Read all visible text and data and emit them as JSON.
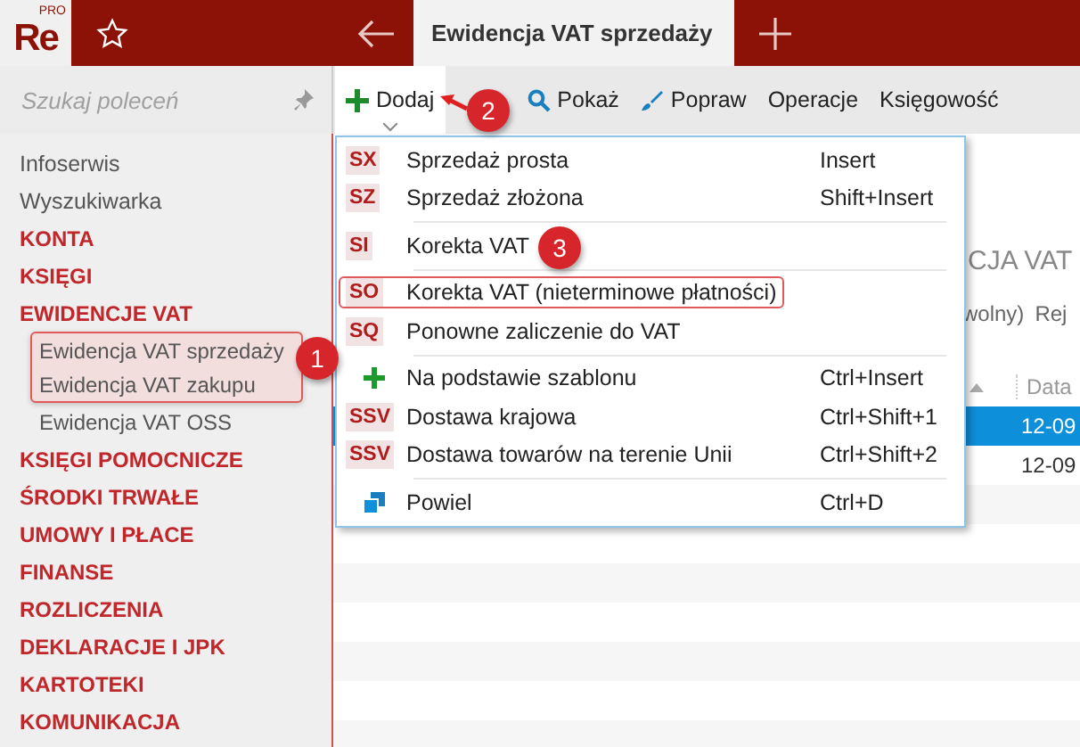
{
  "header": {
    "logo": "Re",
    "logo_sup": "PRO",
    "tab_title": "Ewidencja VAT sprzedaży"
  },
  "sidebar": {
    "search_placeholder": "Szukaj poleceń",
    "items": [
      {
        "label": "Infoserwis",
        "kind": "link"
      },
      {
        "label": "Wyszukiwarka",
        "kind": "link"
      },
      {
        "label": "KONTA",
        "kind": "section"
      },
      {
        "label": "KSIĘGI",
        "kind": "section"
      },
      {
        "label": "EWIDENCJE VAT",
        "kind": "section",
        "children": [
          {
            "label": "Ewidencja VAT sprzedaży",
            "highlighted": true
          },
          {
            "label": "Ewidencja VAT zakupu",
            "highlighted": true
          },
          {
            "label": "Ewidencja VAT OSS",
            "highlighted": false
          }
        ]
      },
      {
        "label": "KSIĘGI POMOCNICZE",
        "kind": "section"
      },
      {
        "label": "ŚRODKI TRWAŁE",
        "kind": "section"
      },
      {
        "label": "UMOWY I PŁACE",
        "kind": "section"
      },
      {
        "label": "FINANSE",
        "kind": "section"
      },
      {
        "label": "ROZLICZENIA",
        "kind": "section"
      },
      {
        "label": "DEKLARACJE I JPK",
        "kind": "section"
      },
      {
        "label": "KARTOTEKI",
        "kind": "section"
      },
      {
        "label": "KOMUNIKACJA",
        "kind": "section"
      }
    ]
  },
  "toolbar": [
    {
      "label": "Dodaj",
      "kind": "add",
      "selected": true
    },
    {
      "label": "Pokaż",
      "kind": "view",
      "selected": false
    },
    {
      "label": "Popraw",
      "kind": "edit",
      "selected": false
    },
    {
      "label": "Operacje",
      "kind": "text",
      "selected": false
    },
    {
      "label": "Księgowość",
      "kind": "text",
      "selected": false
    }
  ],
  "background": {
    "heading": "CJA VAT",
    "filter_text": "wolny)",
    "filter_text_2": "Rej",
    "column_header": "Data",
    "rows": [
      {
        "date": "12-09",
        "selected": true
      },
      {
        "date": "12-09",
        "selected": false
      }
    ]
  },
  "menu": {
    "groups": [
      [
        {
          "kind": "code",
          "code": "SX",
          "label": "Sprzedaż prosta",
          "shortcut": "Insert",
          "highlighted": false
        },
        {
          "kind": "code",
          "code": "SZ",
          "label": "Sprzedaż złożona",
          "shortcut": "Shift+Insert",
          "highlighted": false
        }
      ],
      [
        {
          "kind": "code",
          "code": "SI",
          "label": "Korekta VAT",
          "highlighted": false
        }
      ],
      [
        {
          "kind": "code",
          "code": "SO",
          "label": "Korekta VAT (nieterminowe płatności)",
          "highlighted": true
        },
        {
          "kind": "code",
          "code": "SQ",
          "label": "Ponowne zaliczenie do VAT",
          "highlighted": false
        }
      ],
      [
        {
          "kind": "plus",
          "label": "Na podstawie szablonu",
          "shortcut": "Ctrl+Insert",
          "highlighted": false
        },
        {
          "kind": "code",
          "code": "SSV",
          "label": "Dostawa krajowa",
          "shortcut": "Ctrl+Shift+1",
          "highlighted": false
        },
        {
          "kind": "code",
          "code": "SSV",
          "label": "Dostawa towarów na terenie Unii",
          "shortcut": "Ctrl+Shift+2",
          "highlighted": false
        }
      ],
      [
        {
          "kind": "copy",
          "label": "Powiel",
          "shortcut": "Ctrl+D",
          "highlighted": false
        }
      ]
    ]
  },
  "callouts": [
    "1",
    "2",
    "3"
  ]
}
